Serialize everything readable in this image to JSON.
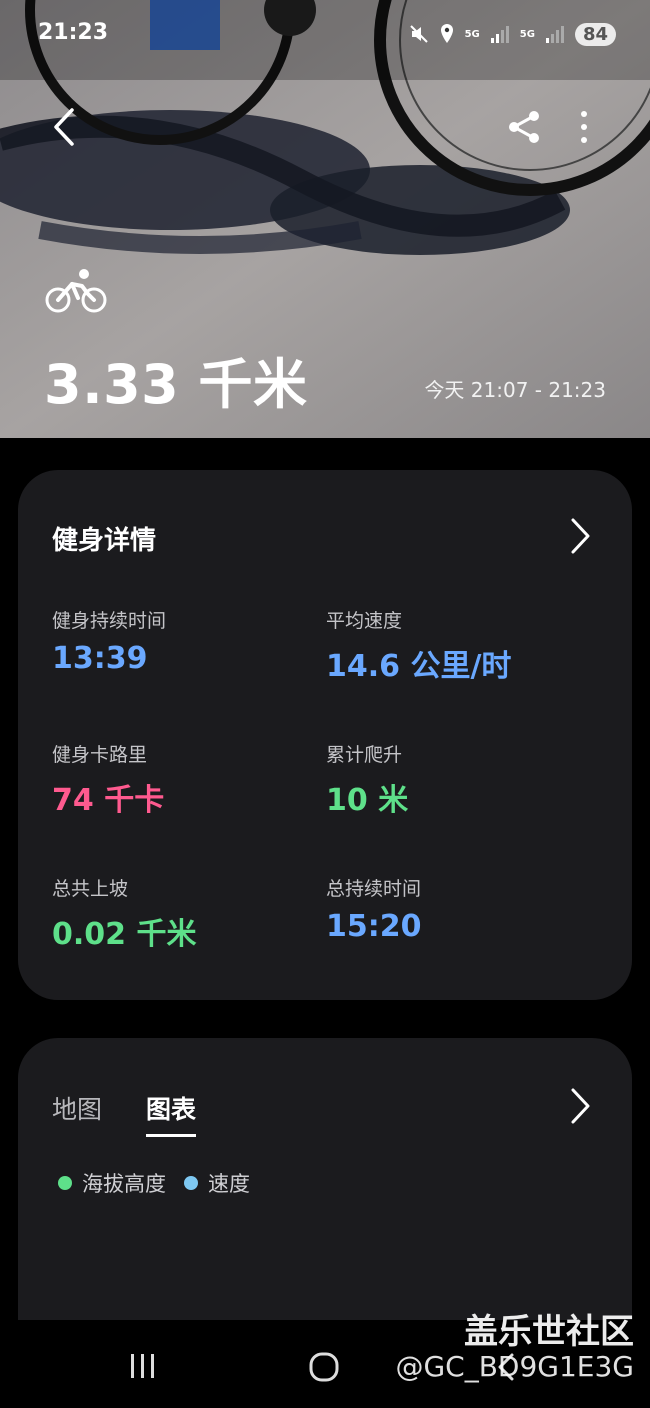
{
  "status": {
    "time": "21:23",
    "sig1": "5G",
    "sig2": "5G",
    "battery": "84"
  },
  "hero": {
    "distance": "3.33 千米",
    "time_range": "今天 21:07 - 21:23"
  },
  "details": {
    "title": "健身详情",
    "stats": [
      {
        "label": "健身持续时间",
        "value": "13:39",
        "color": "#6aa8ff"
      },
      {
        "label": "平均速度",
        "value": "14.6 公里/时",
        "color": "#6aa8ff"
      },
      {
        "label": "健身卡路里",
        "value": "74 千卡",
        "color": "#ff5a8f"
      },
      {
        "label": "累计爬升",
        "value": "10 米",
        "color": "#5ee08a"
      },
      {
        "label": "总共上坡",
        "value": "0.02 千米",
        "color": "#5ee08a"
      },
      {
        "label": "总持续时间",
        "value": "15:20",
        "color": "#6aa8ff"
      }
    ]
  },
  "chart_card": {
    "tabs": [
      "地图",
      "图表"
    ],
    "active_tab": "图表",
    "legend": [
      {
        "name": "海拔高度",
        "color": "#5ee08a"
      },
      {
        "name": "速度",
        "color": "#7ec8f2"
      }
    ]
  },
  "watermark": {
    "line1": "盖乐世社区",
    "line2": "@GC_BD9G1E3G"
  }
}
